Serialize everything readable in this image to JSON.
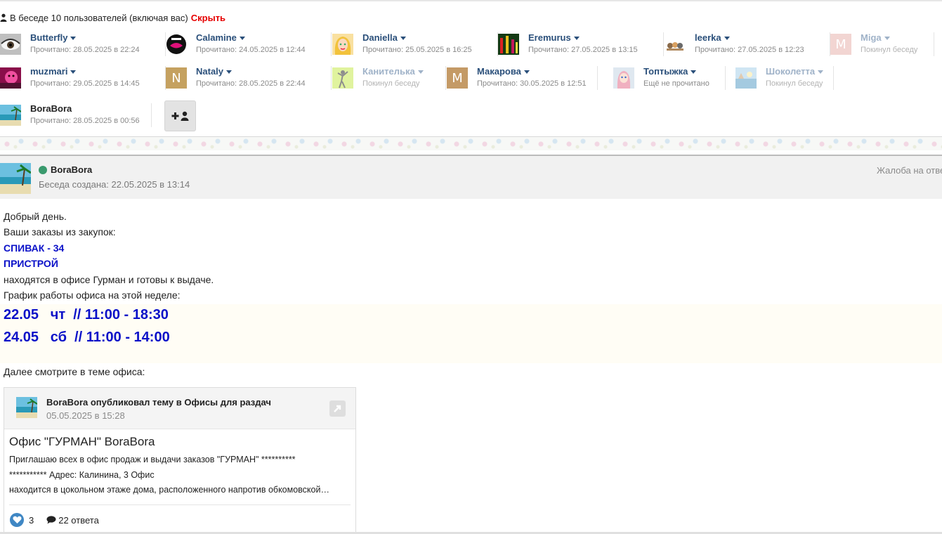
{
  "participants_header": {
    "text": "В беседе 10 пользователей (включая вас)",
    "hide_label": "Скрыть"
  },
  "participants": [
    {
      "name": "Butterfly",
      "status": "Прочитано: 28.05.2025 в 22:24",
      "avatar_icon": "eye-avatar",
      "left": false
    },
    {
      "name": "Calamine",
      "status": "Прочитано: 24.05.2025 в 12:44",
      "avatar_icon": "lips-avatar",
      "left": false
    },
    {
      "name": "Daniella",
      "status": "Прочитано: 25.05.2025 в 16:25",
      "avatar_icon": "blonde-girl-avatar",
      "left": false
    },
    {
      "name": "Eremurus",
      "status": "Прочитано: 27.05.2025 в 13:15",
      "avatar_icon": "flowers-avatar",
      "left": false
    },
    {
      "name": "leerka",
      "status": "Прочитано: 27.05.2025 в 12:23",
      "avatar_icon": "cats-avatar",
      "left": false
    },
    {
      "name": "Miga",
      "status": "Покинул беседу",
      "avatar_letter": "M",
      "avatar_color": "#e8b3ae",
      "left": true
    },
    {
      "name": "muzmari",
      "status": "Прочитано: 29.05.2025 в 14:45",
      "avatar_icon": "pink-face-avatar",
      "left": false
    },
    {
      "name": "Nataly",
      "status": "Прочитано: 28.05.2025 в 22:44",
      "avatar_letter": "N",
      "avatar_color": "#c5a160",
      "left": false
    },
    {
      "name": "Канителька",
      "status": "Покинул беседу",
      "avatar_icon": "dancer-avatar",
      "left": true
    },
    {
      "name": "Макарова",
      "status": "Прочитано: 30.05.2025 в 12:51",
      "avatar_letter": "M",
      "avatar_color": "#c49a66",
      "left": false
    },
    {
      "name": "Топтыжка",
      "status": "Ещё не прочитано",
      "avatar_icon": "doll-avatar",
      "left": false
    },
    {
      "name": "Шоколетта",
      "status": "Покинул беседу",
      "avatar_icon": "sea-avatar",
      "left": true
    },
    {
      "name": "BoraBora",
      "status": "Прочитано: 28.05.2025 в 00:56",
      "avatar_icon": "beach-avatar",
      "left": false
    }
  ],
  "add_user_icon": "add-user-icon",
  "message": {
    "author": "BoraBora",
    "created": "Беседа создана: 22.05.2025 в 13:14",
    "complaint": "Жалоба на отве",
    "lines": [
      "Добрый день.",
      "Ваши заказы из закупок:",
      "СПИВАК - 34",
      "ПРИСТРОЙ",
      "находятся в офисе Гурман и готовы к выдаче.",
      "График работы офиса на этой неделе:"
    ],
    "schedule": [
      "22.05   чт  // 11:00 - 18:30",
      "24.05   сб  // 11:00 - 14:00"
    ],
    "after": "Далее смотрите в теме офиса:"
  },
  "embed": {
    "title": "BoraBora опубликовал тему в Офисы для раздач",
    "date": "05.05.2025 в 15:28",
    "topic": "Офис \"ГУРМАН\" BoraBora",
    "excerpt": [
      "Приглашаю всех в офис продаж и выдачи заказов  \"ГУРМАН\"   **********",
      "*********** Адрес: Калинина, 3 Офис",
      "находится в цокольном этаже дома, расположенного напротив обкомовской…"
    ],
    "likes": "3",
    "replies": "22 ответа"
  },
  "colors": {
    "link_blue": "#2a4f7a",
    "message_blue": "#0a10c8",
    "hide_red": "#e60000",
    "online_green": "#3a9a6e"
  }
}
